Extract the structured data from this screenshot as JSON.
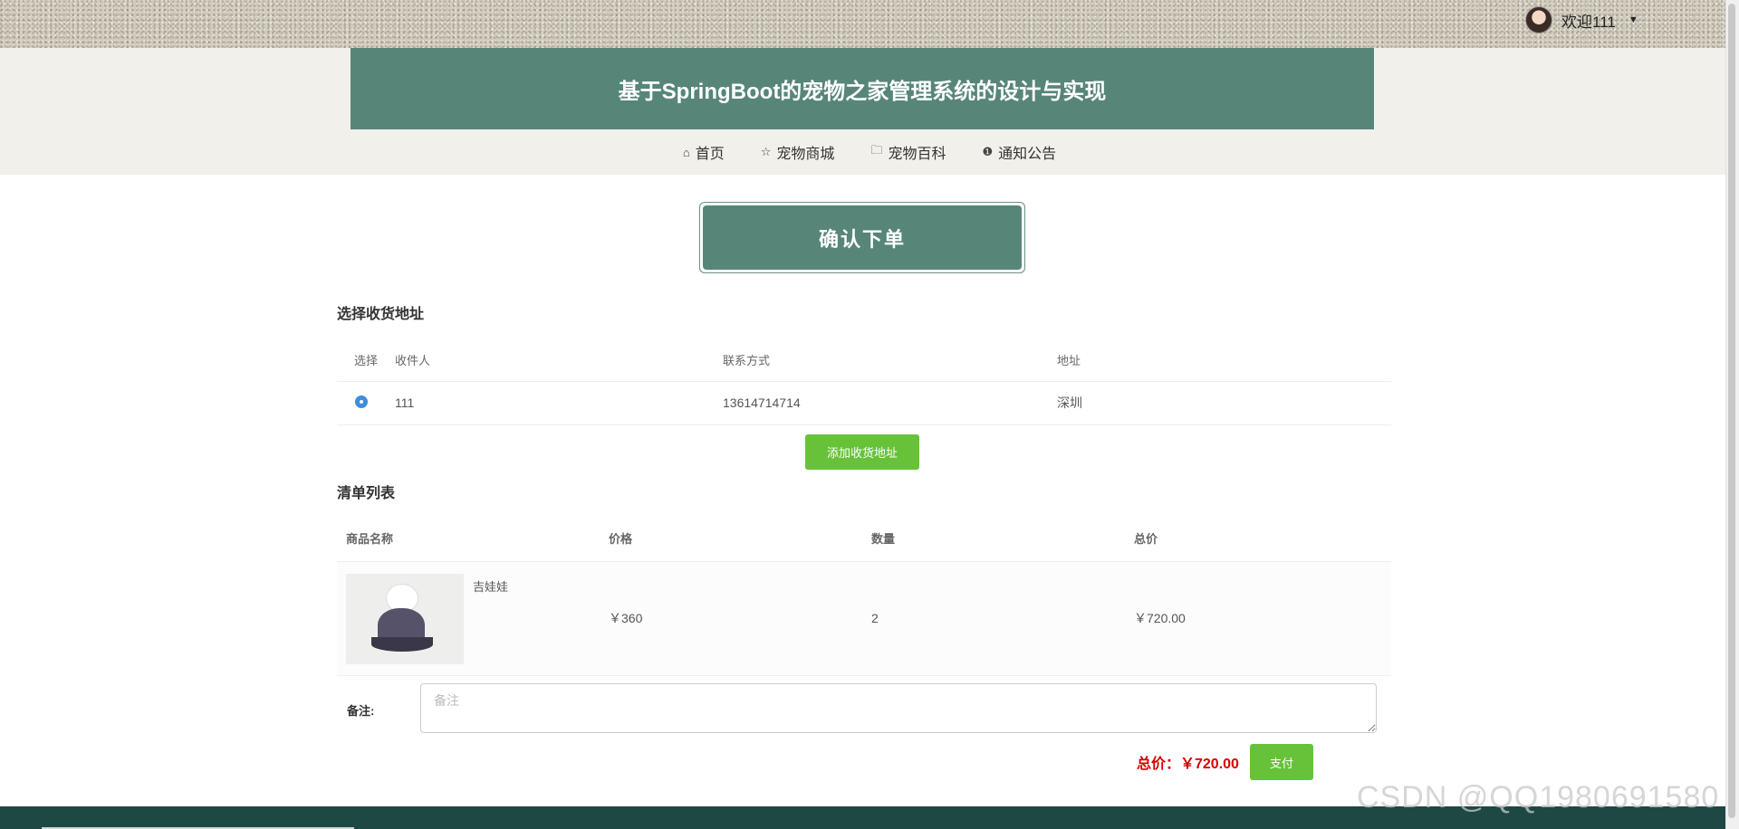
{
  "user": {
    "greeting": "欢迎111",
    "caret": "▼"
  },
  "site": {
    "title": "基于SpringBoot的宠物之家管理系统的设计与实现"
  },
  "nav": [
    {
      "icon": "⌂",
      "label": "首页"
    },
    {
      "icon": "☆",
      "label": "宠物商城"
    },
    {
      "icon": "🗀",
      "label": "宠物百科"
    },
    {
      "icon": "❶",
      "label": "通知公告"
    }
  ],
  "order": {
    "banner": "确认下单"
  },
  "address": {
    "section_title": "选择收货地址",
    "headers": {
      "select": "选择",
      "receiver": "收件人",
      "phone": "联系方式",
      "addr": "地址"
    },
    "rows": [
      {
        "receiver": "111",
        "phone": "13614714714",
        "addr": "深圳"
      }
    ],
    "add_button": "添加收货地址"
  },
  "list": {
    "section_title": "清单列表",
    "headers": {
      "name": "商品名称",
      "price": "价格",
      "qty": "数量",
      "total": "总价"
    },
    "items": [
      {
        "name": "吉娃娃",
        "price": "￥360",
        "qty": "2",
        "total": "￥720.00"
      }
    ]
  },
  "note": {
    "label": "备注:",
    "placeholder": "备注",
    "value": ""
  },
  "summary": {
    "total_label": "总价：￥720.00",
    "pay_button": "支付"
  },
  "watermark": "CSDN @QQ1980691580",
  "colors": {
    "primary": "#578679",
    "accent_green": "#67c23a",
    "price_red": "#d50000",
    "footer": "#1e4844"
  }
}
